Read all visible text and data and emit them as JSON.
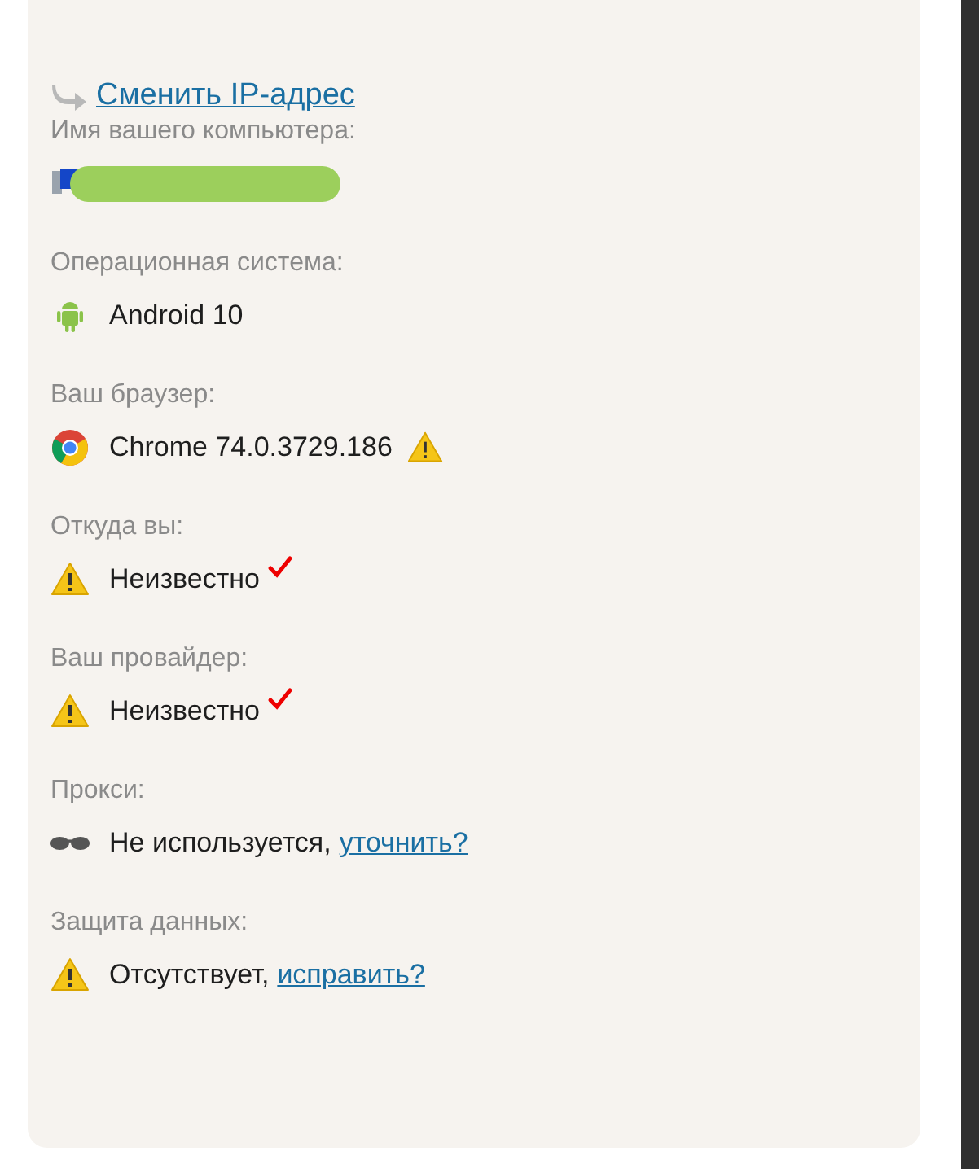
{
  "change_ip_link": "Сменить IP-адрес",
  "rows": [
    {
      "label": "Имя вашего компьютера:",
      "kind": "computer",
      "redacted": true,
      "check": false
    },
    {
      "label": "Операционная система:",
      "kind": "android",
      "value": "Android 10",
      "check": false
    },
    {
      "label": "Ваш браузер:",
      "kind": "chrome",
      "value": "Chrome 74.0.3729.186",
      "warning": true,
      "check": false
    },
    {
      "label": "Откуда вы:",
      "kind": "warning",
      "value": "Неизвестно",
      "check": true
    },
    {
      "label": "Ваш провайдер:",
      "kind": "warning",
      "value": "Неизвестно",
      "check": true
    },
    {
      "label": "Прокси:",
      "kind": "glasses",
      "value": "Не используется,",
      "link": "уточнить?",
      "check": false
    },
    {
      "label": "Защита данных:",
      "kind": "warning",
      "value": "Отсутствует,",
      "link": "исправить?",
      "check": false
    }
  ]
}
